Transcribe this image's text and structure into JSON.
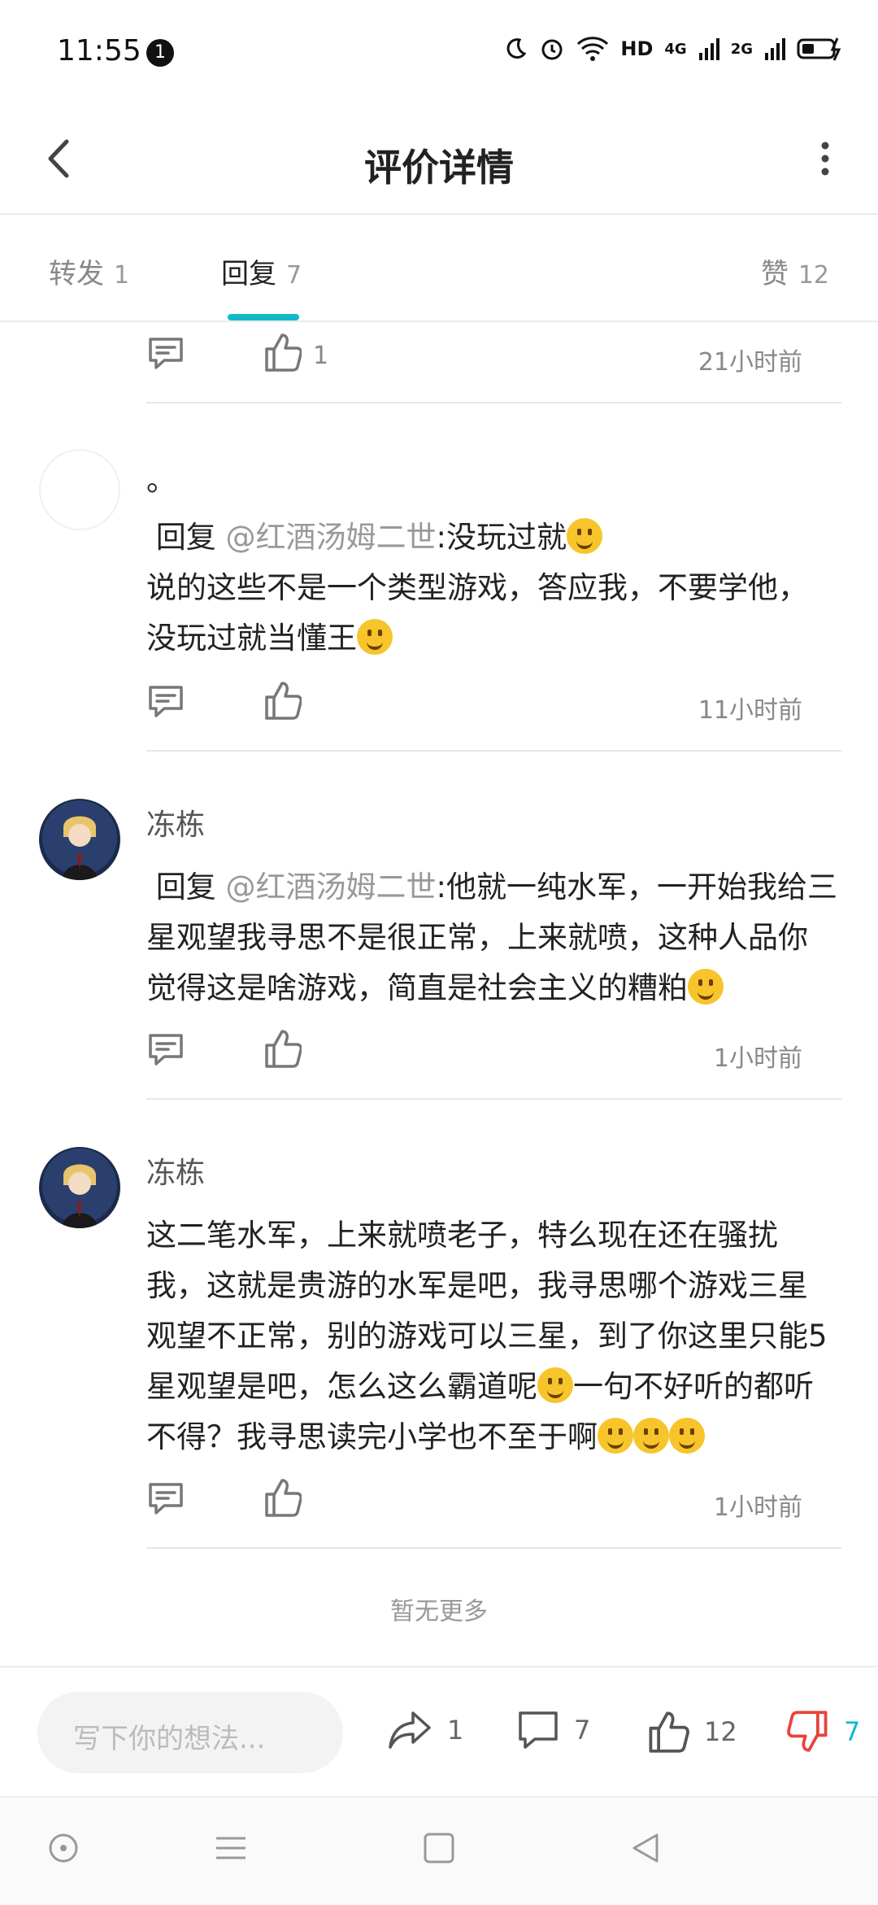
{
  "status": {
    "time": "11:55",
    "notif_count": "1",
    "network1": "HD",
    "network2": "4G",
    "network3": "2G"
  },
  "header": {
    "title": "评价详情"
  },
  "tabs": [
    {
      "label": "转发",
      "count": "1"
    },
    {
      "label": "回复",
      "count": "7"
    },
    {
      "label": "赞",
      "count": "12"
    }
  ],
  "first_actions": {
    "like_count": "1",
    "time": "21小时前"
  },
  "replies": [
    {
      "name": "",
      "first_line": "。",
      "reply_prefix": "回复",
      "mention": "@红酒汤姆二世",
      "text1": ":没玩过就",
      "text2": "说的这些不是一个类型游戏，答应我，不要学他，没玩过就当懂王",
      "time": "11小时前"
    },
    {
      "name": "冻栋",
      "reply_prefix": "回复",
      "mention": "@红酒汤姆二世",
      "text1": ":他就一纯水军，一开始我给三星观望我寻思不是很正常，上来就喷，这种人品你觉得这是啥游戏，简直是社会主义的糟粕",
      "time": "1小时前"
    },
    {
      "name": "冻栋",
      "text1": "这二笔水军，上来就喷老子，特么现在还在骚扰我，这就是贵游的水军是吧，我寻思哪个游戏三星观望不正常，别的游戏可以三星，到了你这里只能5星观望是吧，怎么这么霸道呢",
      "text2": "一句不好听的都听不得？我寻思读完小学也不至于啊",
      "time": "1小时前"
    }
  ],
  "no_more": "暂无更多",
  "bottom": {
    "placeholder": "写下你的想法...",
    "share_count": "1",
    "comment_count": "7",
    "like_count": "12",
    "dislike_count": "7"
  },
  "colors": {
    "accent": "#14b9c8",
    "dislike": "#e8443a"
  }
}
